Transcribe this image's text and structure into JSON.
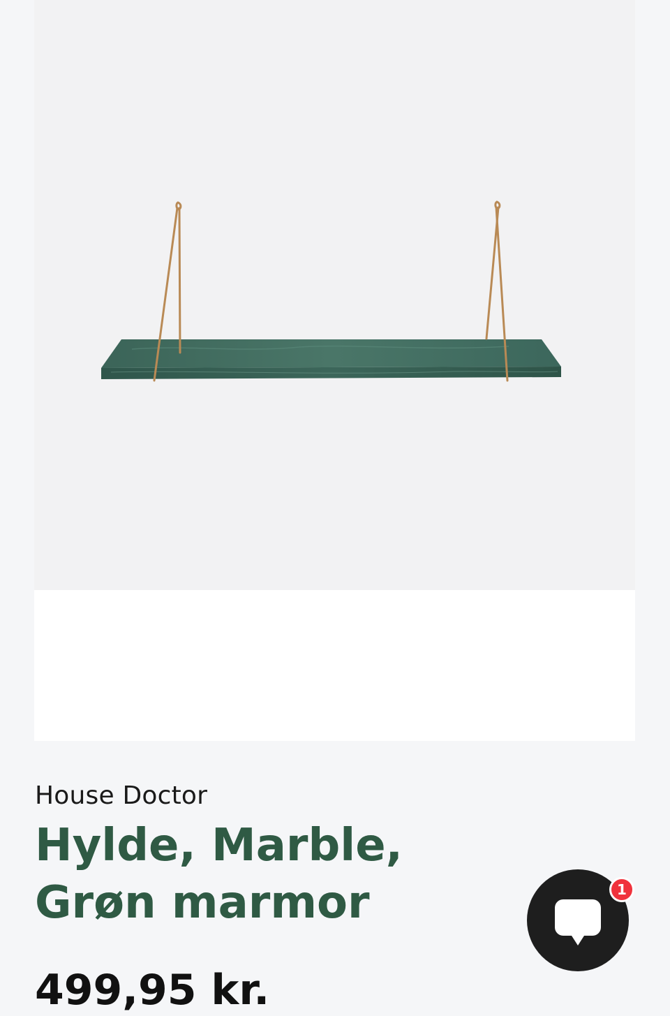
{
  "product": {
    "brand": "House Doctor",
    "title": "Hylde, Marble, Grøn marmor",
    "price": "499,95 kr."
  },
  "image": {
    "subject": "green marble wall shelf with brass wire brackets",
    "marble_color": "#3f6b60",
    "bracket_color": "#b98a55"
  },
  "chat": {
    "icon": "chat-bubble-icon",
    "badge_count": "1",
    "badge_color": "#f0323c",
    "button_color": "#1e1e1e"
  },
  "colors": {
    "title": "#2f5a44",
    "background": "#f5f6f8"
  }
}
